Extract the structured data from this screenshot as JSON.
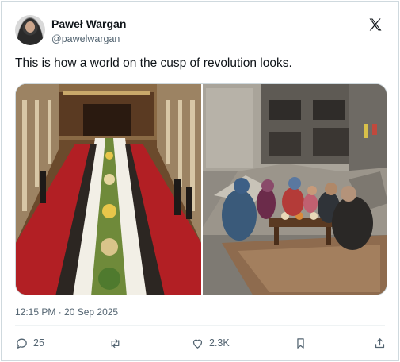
{
  "author": {
    "display_name": "Paweł Wargan",
    "handle": "@pawelwargan",
    "avatar_icon": "profile-photo"
  },
  "platform_icon": "x-logo-icon",
  "tweet": {
    "text": "This is how a world on the cusp of revolution looks.",
    "timestamp": "12:15 PM · 20 Sep 2025"
  },
  "media": {
    "left_image": "banquet-hall-photo",
    "right_image": "rubble-family-meal-photo"
  },
  "actions": {
    "reply_count": "25",
    "retweet_count": "",
    "like_count": "2.3K",
    "icons": [
      "reply-icon",
      "retweet-icon",
      "like-icon",
      "bookmark-icon",
      "share-icon"
    ]
  },
  "colors": {
    "text": "#0f1419",
    "secondary": "#536471",
    "border": "#cfd9de"
  }
}
